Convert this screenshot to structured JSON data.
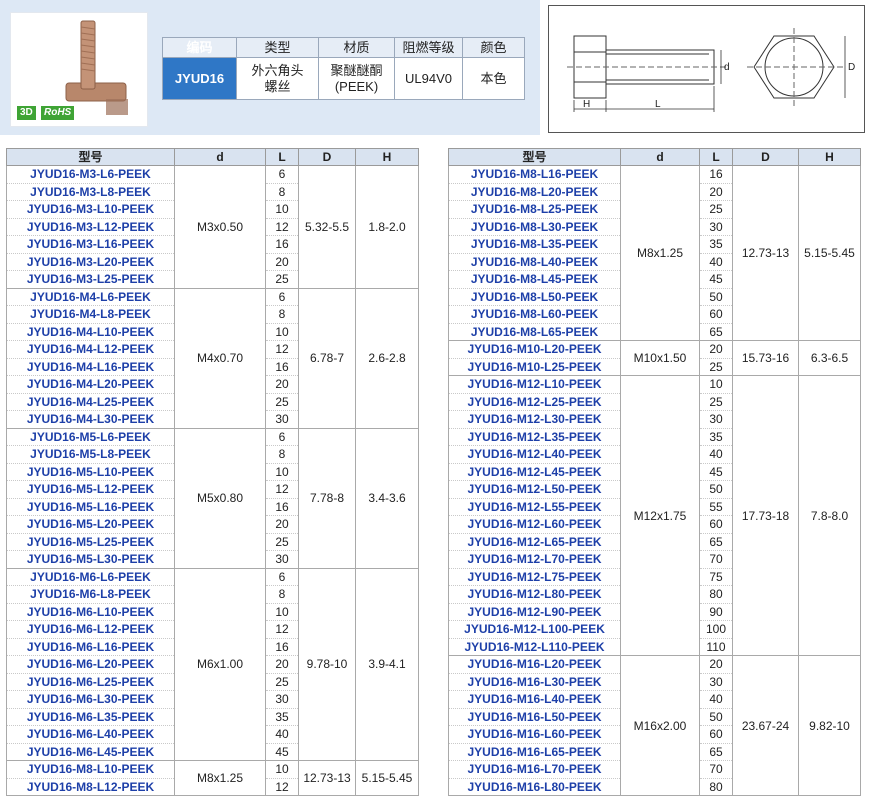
{
  "spec": {
    "headers": [
      "编码",
      "类型",
      "材质",
      "阻燃等级",
      "颜色"
    ],
    "values": [
      [
        "JYUD16"
      ],
      [
        "外六角头",
        "螺丝"
      ],
      [
        "聚醚醚酮",
        "(PEEK)"
      ],
      [
        "UL94V0"
      ],
      [
        "本色"
      ]
    ]
  },
  "badges": {
    "three_d": "3D",
    "rohs": "RoHS"
  },
  "drawing": {
    "label_h": "H",
    "label_l": "L",
    "label_d": "d",
    "label_big_d": "D"
  },
  "table_headers": [
    "型号",
    "d",
    "L",
    "D",
    "H"
  ],
  "left_groups": [
    {
      "prefix": "JYUD16-M3",
      "d": "M3x0.50",
      "D": "5.32-5.5",
      "H": "1.8-2.0",
      "lengths": [
        "6",
        "8",
        "10",
        "12",
        "16",
        "20",
        "25"
      ]
    },
    {
      "prefix": "JYUD16-M4",
      "d": "M4x0.70",
      "D": "6.78-7",
      "H": "2.6-2.8",
      "lengths": [
        "6",
        "8",
        "10",
        "12",
        "16",
        "20",
        "25",
        "30"
      ]
    },
    {
      "prefix": "JYUD16-M5",
      "d": "M5x0.80",
      "D": "7.78-8",
      "H": "3.4-3.6",
      "lengths": [
        "6",
        "8",
        "10",
        "12",
        "16",
        "20",
        "25",
        "30"
      ]
    },
    {
      "prefix": "JYUD16-M6",
      "d": "M6x1.00",
      "D": "9.78-10",
      "H": "3.9-4.1",
      "lengths": [
        "6",
        "8",
        "10",
        "12",
        "16",
        "20",
        "25",
        "30",
        "35",
        "40",
        "45"
      ]
    },
    {
      "prefix": "JYUD16-M8",
      "d": "M8x1.25",
      "D": "12.73-13",
      "H": "5.15-5.45",
      "lengths": [
        "10",
        "12"
      ]
    }
  ],
  "right_groups": [
    {
      "prefix": "JYUD16-M8",
      "d": "M8x1.25",
      "D": "12.73-13",
      "H": "5.15-5.45",
      "lengths": [
        "16",
        "20",
        "25",
        "30",
        "35",
        "40",
        "45",
        "50",
        "60",
        "65"
      ],
      "cells": [
        "JYUD16-M8-L16-PEEK",
        "JYUD16-M8-L20-PEEK",
        "JYUD16-M8-L25-PEEK",
        "JYUD16-M8-L30-PEEK",
        "JYUD16-M8-L35-PEEK",
        "JYUD16-M8-L40-PEEK",
        "JYUD16-M8-L45-PEEK",
        "JYUD16-M8-L50-PEEK",
        "JYUD16-M8-L60-PEEK",
        "JYUD16-M8-L65-PEEK"
      ]
    },
    {
      "prefix": "JYUD16-M10",
      "d": "M10x1.50",
      "D": "15.73-16",
      "H": "6.3-6.5",
      "lengths": [
        "20",
        "25"
      ]
    },
    {
      "prefix": "JYUD16-M12",
      "d": "M12x1.75",
      "D": "17.73-18",
      "H": "7.8-8.0",
      "lengths": [
        "10",
        "25",
        "30",
        "35",
        "40",
        "45",
        "50",
        "55",
        "60",
        "65",
        "70",
        "75",
        "80",
        "90",
        "100",
        "110"
      ]
    },
    {
      "prefix": "JYUD16-M16",
      "d": "M16x2.00",
      "D": "23.67-24",
      "H": "9.82-10",
      "lengths": [
        "20",
        "30",
        "40",
        "50",
        "60",
        "65",
        "70",
        "80"
      ]
    }
  ]
}
